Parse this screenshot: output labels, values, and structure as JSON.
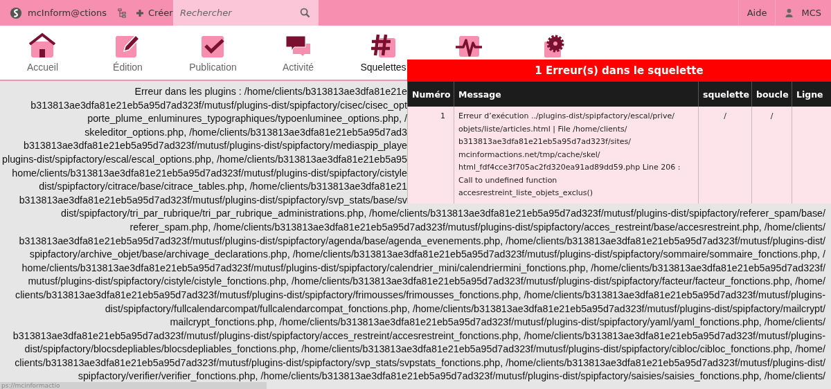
{
  "topbar": {
    "site_name": "mcInform@ctions",
    "create_label": "Créer",
    "search": {
      "placeholder": "Rechercher"
    },
    "help": "Aide",
    "user": "MCS"
  },
  "nav": [
    {
      "kind": "home",
      "label": "Accueil",
      "selected": false
    },
    {
      "kind": "edit",
      "label": "Édition",
      "selected": false
    },
    {
      "kind": "check",
      "label": "Publication",
      "selected": false
    },
    {
      "kind": "chat",
      "label": "Activité",
      "selected": false
    },
    {
      "kind": "hash",
      "label": "Squelettes",
      "selected": true
    },
    {
      "kind": "pulse"
    },
    {
      "kind": "gear"
    }
  ],
  "plugin_errors": {
    "lines_behind_panel": [
      "Erreur dans les plugins : /home/clients/b313813ae3dfa81e21e",
      "b313813ae3dfa81e21eb5a95d7ad323f/mutusf/plugins-dist/spipfactory/cisec/cisec_opt",
      "porte_plume_enluminures_typographiques/typoenluminee_options.php, /",
      "skeleditor_options.php, /home/clients/b313813ae3dfa81e21eb5a95d7ad3",
      "b313813ae3dfa81e21eb5a95d7ad323f/mutusf/plugins-dist/spipfactory/mediaspip_playe",
      "plugins-dist/spipfactory/escal/escal_options.php, /home/clients/b313813ae3dfa81e21eb5a95",
      "home/clients/b313813ae3dfa81e21eb5a95d7ad323f/mutusf/plugins-dist/spipfactory/cistyle",
      "dist/spipfactory/citrace/base/citrace_tables.php, /home/clients/b313813ae3dfa81e21",
      "b313813ae3dfa81e21eb5a95d7ad323f/mutusf/plugins-dist/spipfactory/svp_stats/base/sv"
    ],
    "lines": [
      "dist/spipfactory/tri_par_rubrique/tri_par_rubrique_administrations.php, /home/clients/b313813ae3dfa81e21eb5a95d7ad323f/mutusf/plugins-dist/spipfactory/referer_spam/base/",
      "referer_spam.php, /home/clients/b313813ae3dfa81e21eb5a95d7ad323f/mutusf/plugins-dist/spipfactory/acces_restreint/base/accesrestreint.php, /home/clients/",
      "b313813ae3dfa81e21eb5a95d7ad323f/mutusf/plugins-dist/spipfactory/agenda/base/agenda_evenements.php, /home/clients/b313813ae3dfa81e21eb5a95d7ad323f/mutusf/plugins-dist/",
      "spipfactory/archive_objet/base/archivage_declarations.php, /home/clients/b313813ae3dfa81e21eb5a95d7ad323f/mutusf/plugins-dist/spipfactory/sommaire/sommaire_fonctions.php, /",
      "home/clients/b313813ae3dfa81e21eb5a95d7ad323f/mutusf/plugins-dist/spipfactory/calendrier_mini/calendriermini_fonctions.php, /home/clients/b313813ae3dfa81e21eb5a95d7ad323f/",
      "mutusf/plugins-dist/spipfactory/cistyle/cistyle_fonctions.php, /home/clients/b313813ae3dfa81e21eb5a95d7ad323f/mutusf/plugins-dist/spipfactory/facteur/facteur_fonctions.php, /home/",
      "clients/b313813ae3dfa81e21eb5a95d7ad323f/mutusf/plugins-dist/spipfactory/frimousses/frimousses_fonctions.php, /home/clients/b313813ae3dfa81e21eb5a95d7ad323f/mutusf/plugins-",
      "dist/spipfactory/fullcalendarcompat/fullcalendarcompat_fonctions.php, /home/clients/b313813ae3dfa81e21eb5a95d7ad323f/mutusf/plugins-dist/spipfactory/mailcrypt/",
      "mailcrypt_fonctions.php, /home/clients/b313813ae3dfa81e21eb5a95d7ad323f/mutusf/plugins-dist/spipfactory/yaml/yaml_fonctions.php, /home/clients/",
      "b313813ae3dfa81e21eb5a95d7ad323f/mutusf/plugins-dist/spipfactory/acces_restreint/accesrestreint_fonctions.php, /home/clients/b313813ae3dfa81e21eb5a95d7ad323f/mutusf/plugins-",
      "dist/spipfactory/blocsdepliables/blocsdepliables_fonctions.php, /home/clients/b313813ae3dfa81e21eb5a95d7ad323f/mutusf/plugins-dist/spipfactory/cibloc/cibloc_fonctions.php, /home/",
      "clients/b313813ae3dfa81e21eb5a95d7ad323f/mutusf/plugins-dist/spipfactory/svp_stats/svpstats_fonctions.php, /home/clients/b313813ae3dfa81e21eb5a95d7ad323f/mutusf/plugins-dist/",
      "spipfactory/verifier/verifier_fonctions.php, /home/clients/b313813ae3dfa81e21eb5a95d7ad323f/mutusf/plugins-dist/spipfactory/saisies/saisies_fonctions.php, /home/clients/"
    ]
  },
  "error_panel": {
    "title": "1 Erreur(s) dans le squelette",
    "columns": [
      "Numéro",
      "Message",
      "squelette",
      "boucle",
      "Ligne"
    ],
    "rows": [
      {
        "numero": "1",
        "message": "Erreur d’exécution ../plugins-dist/spipfactory/escal/prive/\nobjets/liste/articles.html | File /home/clients/\nb313813ae3dfa81e21eb5a95d7ad323f/sites/\nmcinformactions.net/tmp/cache/skel/\nhtml_fdf4cce3f705ac2fd320ea91ad89dd59.php Line 206 :\nCall to undefined function\naccesrestreint_liste_objets_exclus()",
        "squelette": "/",
        "boucle": "/"
      }
    ]
  },
  "status_url": "ps://mcinformactio"
}
